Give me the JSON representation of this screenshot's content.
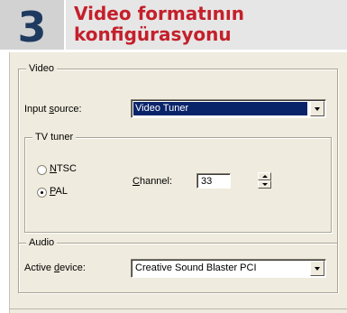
{
  "header": {
    "step_number": "3",
    "title_line1": "Video formatının",
    "title_line2": "konfigürasyonu"
  },
  "video_group": {
    "legend": "Video",
    "input_source": {
      "label_pre": "Input ",
      "label_accel": "s",
      "label_post": "ource:",
      "value": "Video Tuner"
    }
  },
  "tv_tuner_group": {
    "legend": "TV tuner",
    "ntsc": {
      "accel": "N",
      "rest": "TSC",
      "checked": false
    },
    "pal": {
      "accel": "P",
      "rest": "AL",
      "checked": true
    },
    "channel": {
      "label_accel": "C",
      "label_rest": "hannel:",
      "value": "33"
    }
  },
  "audio_group": {
    "legend": "Audio",
    "active_device": {
      "label_pre": "Active ",
      "label_accel": "d",
      "label_post": "evice:",
      "value": "Creative Sound Blaster PCI"
    }
  },
  "colors": {
    "step_number": "#1f3a5f",
    "title": "#c4202b",
    "dialog_bg": "#efebde",
    "selection": "#0a246a"
  }
}
